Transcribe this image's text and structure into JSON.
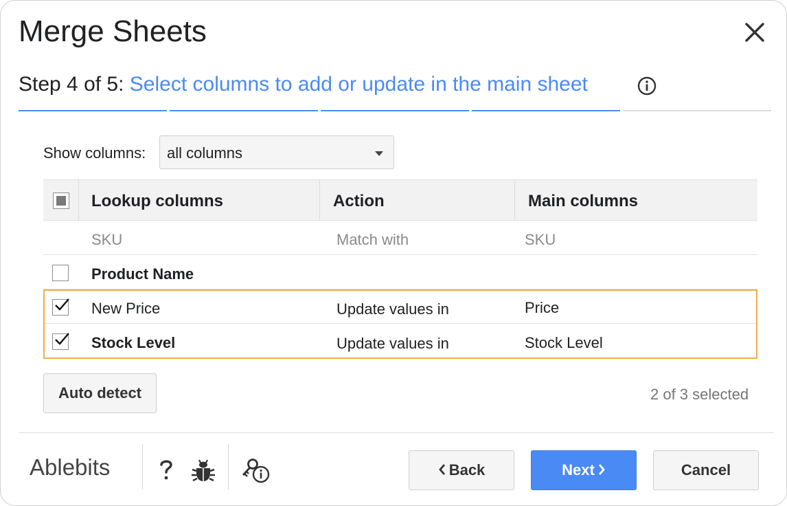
{
  "dialog": {
    "title": "Merge Sheets",
    "close_icon": "close-icon"
  },
  "step": {
    "label": "Step 4 of 5:",
    "description": "Select columns to add or update in the main sheet",
    "info_icon": "info-icon",
    "current": 4,
    "total": 5
  },
  "filter": {
    "label": "Show columns:",
    "selected": "all columns"
  },
  "table": {
    "headers": [
      "Lookup columns",
      "Action",
      "Main columns"
    ],
    "key_row": {
      "lookup": "SKU",
      "action": "Match with",
      "main": "SKU"
    },
    "rows": [
      {
        "checked": false,
        "lookup": "Product Name",
        "action": "",
        "main": ""
      },
      {
        "checked": true,
        "lookup": "New Price",
        "action": "Update values in",
        "main": "Price"
      },
      {
        "checked": true,
        "lookup": "Stock Level",
        "action": "Update values in",
        "main": "Stock Level"
      }
    ]
  },
  "auto_detect_label": "Auto detect",
  "selection_count": "2 of 3 selected",
  "footer": {
    "brand": "Ablebits",
    "help_icon": "question-mark-icon",
    "bug_icon": "bug-icon",
    "license_icon": "key-info-icon",
    "back_label": "Back",
    "next_label": "Next",
    "cancel_label": "Cancel"
  },
  "colors": {
    "accent": "#4a8af4",
    "highlight": "#f0ad4e",
    "progress_inactive": "#dcdcdc"
  }
}
